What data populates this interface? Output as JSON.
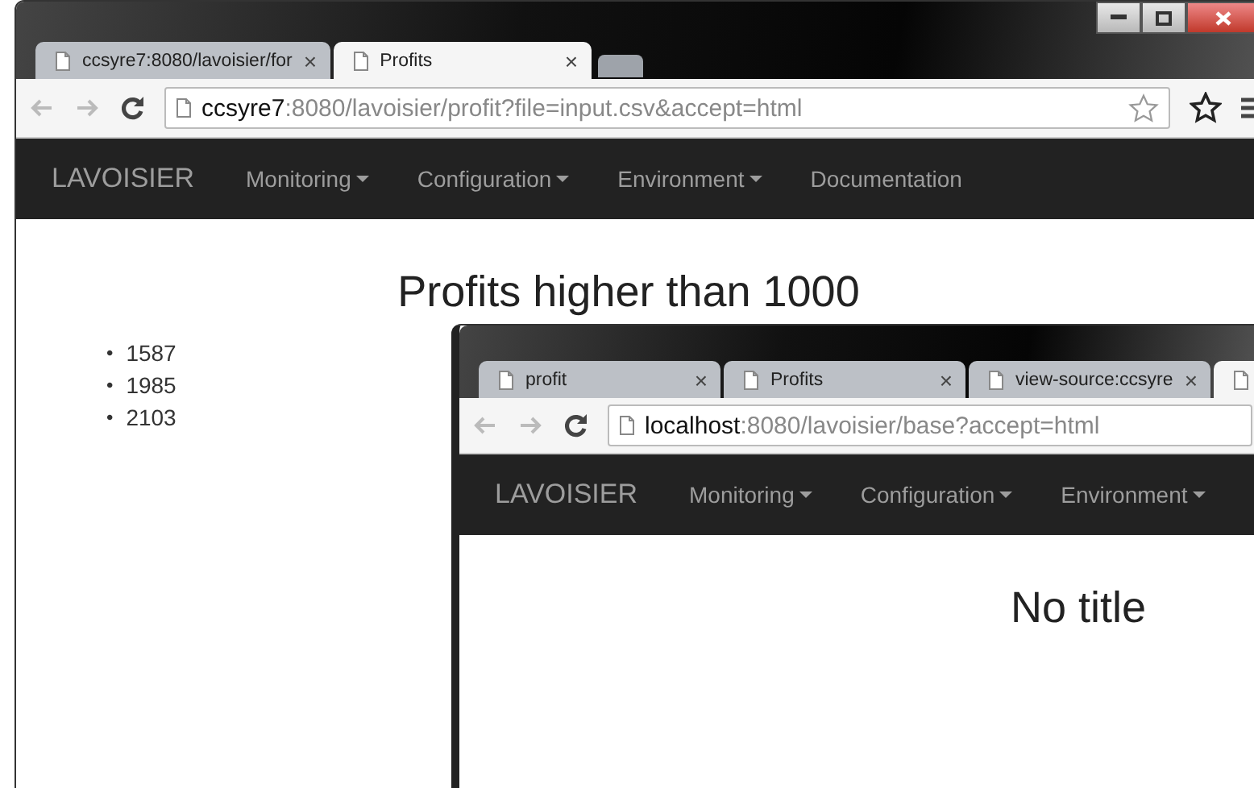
{
  "windows": [
    {
      "window_controls": true,
      "toolbar_icons": true,
      "new_tab": true,
      "tabs": [
        {
          "label": "ccsyre7:8080/lavoisier/for",
          "close": "×",
          "selected": false
        },
        {
          "label": "Profits",
          "close": "×",
          "selected": true
        }
      ],
      "address": {
        "host": "ccsyre7",
        "rest": ":8080/lavoisier/profit?file=input.csv&accept=html"
      },
      "navbar": {
        "brand": "LAVOISIER",
        "menu": [
          {
            "label": "Monitoring",
            "dropdown": true
          },
          {
            "label": "Configuration",
            "dropdown": true
          },
          {
            "label": "Environment",
            "dropdown": true
          },
          {
            "label": "Documentation",
            "dropdown": false
          }
        ]
      },
      "heading": "Profits higher than 1000",
      "list": [
        {
          "bullet": "•",
          "text": "1587"
        },
        {
          "bullet": "•",
          "text": "1985"
        },
        {
          "bullet": "•",
          "text": "2103"
        }
      ]
    },
    {
      "window_controls": false,
      "toolbar_icons": false,
      "new_tab": false,
      "tabs": [
        {
          "label": "profit",
          "close": "×",
          "selected": false
        },
        {
          "label": "Profits",
          "close": "×",
          "selected": false
        },
        {
          "label": "view-source:ccsyre",
          "close": "×",
          "selected": false
        },
        {
          "selected": true
        }
      ],
      "address": {
        "host": "localhost",
        "rest": ":8080/lavoisier/base?accept=html"
      },
      "navbar": {
        "brand": "LAVOISIER",
        "menu": [
          {
            "label": "Monitoring",
            "dropdown": true
          },
          {
            "label": "Configuration",
            "dropdown": true
          },
          {
            "label": "Environment",
            "dropdown": true
          }
        ]
      },
      "heading": "No title"
    }
  ]
}
